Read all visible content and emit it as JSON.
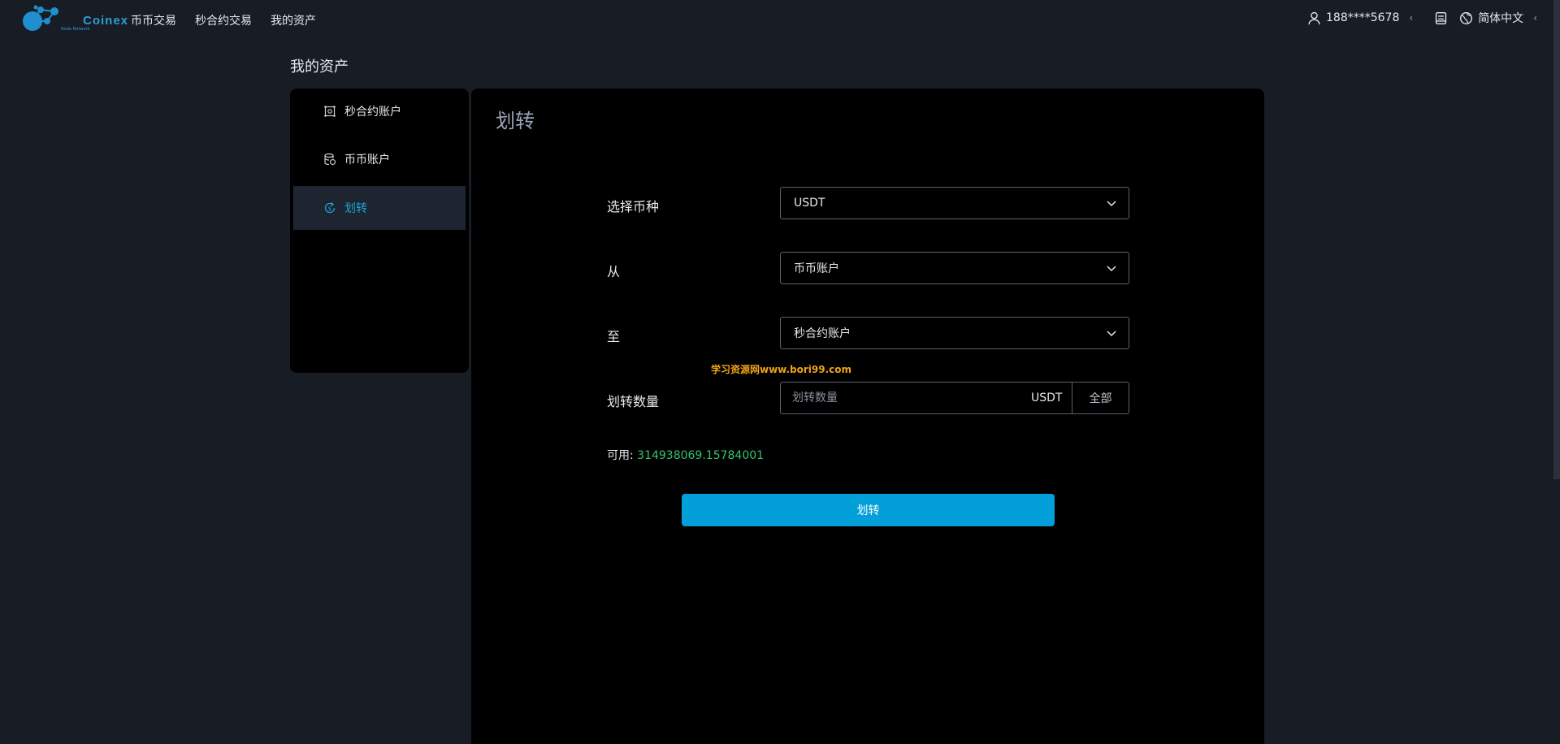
{
  "logo": {
    "text": "Coinex",
    "subtext": "Node Network"
  },
  "nav": [
    "币币交易",
    "秒合约交易",
    "我的资产"
  ],
  "header_right": {
    "user": "188****5678",
    "language": "简体中文"
  },
  "page_title": "我的资产",
  "sidebar": {
    "items": [
      {
        "label": "秒合约账户",
        "icon": "contract-icon",
        "active": false
      },
      {
        "label": "币币账户",
        "icon": "coins-icon",
        "active": false
      },
      {
        "label": "划转",
        "icon": "transfer-icon",
        "active": true
      }
    ]
  },
  "main": {
    "title": "划转",
    "form": {
      "currency_label": "选择币种",
      "currency_value": "USDT",
      "from_label": "从",
      "from_value": "币币账户",
      "to_label": "至",
      "to_value": "秒合约账户",
      "amount_label": "划转数量",
      "amount_placeholder": "划转数量",
      "amount_unit": "USDT",
      "all_label": "全部",
      "available_label": "可用:",
      "available_value": "314938069.15784001",
      "submit_label": "划转"
    },
    "watermark": "学习资源网www.bori99.com"
  },
  "colors": {
    "accent": "#029fd9",
    "available": "#35c26c",
    "background": "#181c25",
    "panel": "#000000"
  }
}
